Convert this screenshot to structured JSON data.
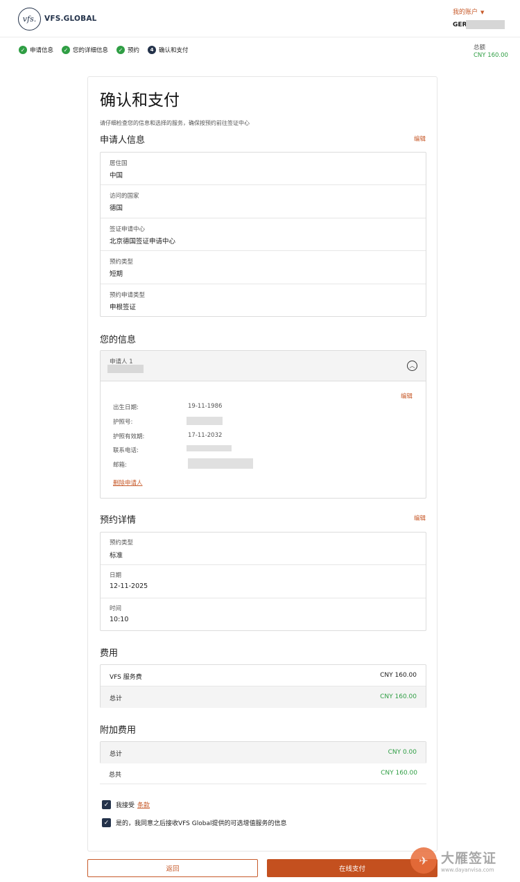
{
  "header": {
    "logo_mark": "vfs.",
    "logo_text": "VFS.GLOBAL",
    "account_label": "我的账户",
    "user_code": "GER"
  },
  "steps": [
    {
      "label": "申请信息",
      "state": "done"
    },
    {
      "label": "您的详细信息",
      "state": "done"
    },
    {
      "label": "预约",
      "state": "done"
    },
    {
      "label": "确认和支付",
      "state": "current",
      "number": "4"
    }
  ],
  "summary": {
    "total_label": "总额",
    "total_value": "CNY 160.00"
  },
  "page": {
    "title": "确认和支付",
    "subtitle": "请仔细检查您的信息和选择的服务，确保按预约前往签证中心"
  },
  "applicant_info": {
    "title": "申请人信息",
    "edit": "编辑",
    "rows": [
      {
        "label": "居住国",
        "value": "中国"
      },
      {
        "label": "访问的国家",
        "value": "德国"
      },
      {
        "label": "签证申请中心",
        "value": "北京德国签证申请中心"
      },
      {
        "label": "预约类型",
        "value": "短期"
      },
      {
        "label": "预约申请类型",
        "value": "申根签证"
      }
    ]
  },
  "your_info": {
    "title": "您的信息",
    "applicant_label": "申请人 1",
    "edit": "编辑",
    "fields": [
      {
        "label": "出生日期:",
        "value": "19-11-1986"
      },
      {
        "label": "护照号:",
        "value": ""
      },
      {
        "label": "护照有效期:",
        "value": "17-11-2032"
      },
      {
        "label": "联系电话:",
        "value": ""
      },
      {
        "label": "邮箱:",
        "value": ""
      }
    ],
    "delete": "删除申请人"
  },
  "appointment": {
    "title": "预约详情",
    "edit": "编辑",
    "rows": [
      {
        "label": "预约类型",
        "value": "标准"
      },
      {
        "label": "日期",
        "value": "12-11-2025"
      },
      {
        "label": "时间",
        "value": "10:10"
      }
    ]
  },
  "fees": {
    "title": "费用",
    "service_label": "VFS 服务费",
    "service_amount": "CNY 160.00",
    "subtotal_label": "总计",
    "subtotal_amount": "CNY 160.00"
  },
  "extra_fees": {
    "title": "附加费用",
    "subtotal_label": "总计",
    "subtotal_amount": "CNY 0.00",
    "grand_label": "总共",
    "grand_amount": "CNY 160.00"
  },
  "consents": {
    "accept_text": "我接受",
    "terms_link": "条款",
    "marketing_text": "是的，我同意之后接收VFS Global提供的可选增值服务的信息"
  },
  "buttons": {
    "back": "返回",
    "pay": "在线支付"
  },
  "watermark": {
    "brand": "大雁签证",
    "url": "www.dayanvisa.com"
  }
}
